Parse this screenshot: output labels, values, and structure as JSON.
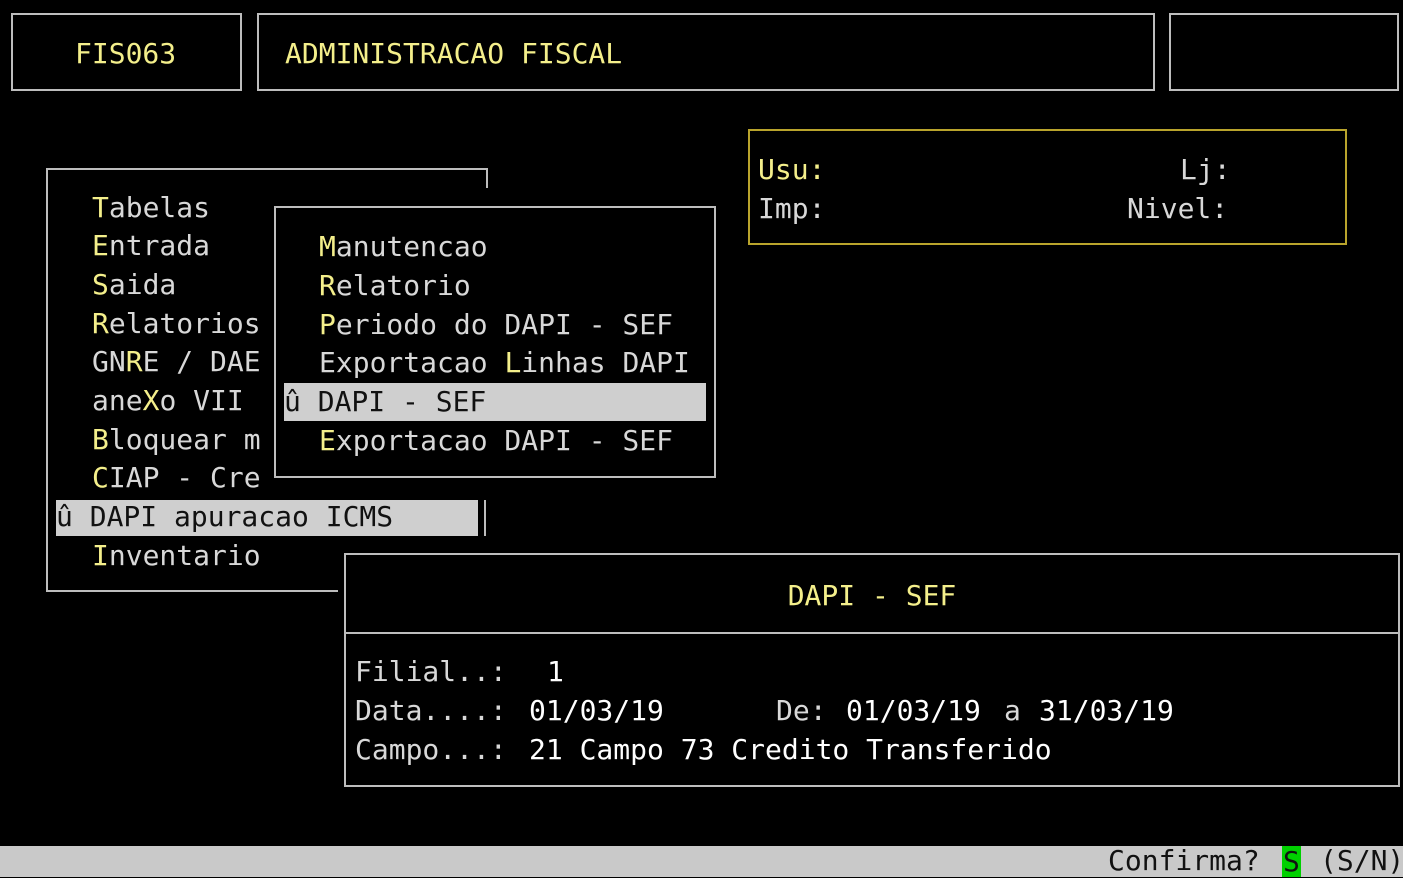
{
  "header": {
    "program_code": "FIS063",
    "title": "ADMINISTRACAO FISCAL",
    "right_box": ""
  },
  "info": {
    "usu_label": "Usu:",
    "lj_label": "Lj:",
    "imp_label": "Imp:",
    "nivel_label": "Nivel:"
  },
  "main_menu": {
    "items": [
      {
        "hot": "T",
        "rest": "abelas"
      },
      {
        "hot": "E",
        "rest": "ntrada"
      },
      {
        "hot": "S",
        "rest": "aida"
      },
      {
        "hot": "R",
        "rest": "elatorios"
      },
      {
        "pre": "GN",
        "hot": "R",
        "rest": "E / DAE"
      },
      {
        "pre": "ane",
        "hot": "X",
        "rest": "o VII"
      },
      {
        "hot": "B",
        "rest": "loquear m"
      },
      {
        "pre": "",
        "hot": "C",
        "rest": "IAP - Cre"
      },
      {
        "selected": "û DAPI apuracao ICMS"
      },
      {
        "hot": "I",
        "rest": "nventario"
      }
    ]
  },
  "sub_menu": {
    "items": [
      {
        "hot": "M",
        "rest": "anutencao"
      },
      {
        "hot": "R",
        "rest": "elatorio"
      },
      {
        "hot": "P",
        "rest": "eriodo do DAPI - SEF"
      },
      {
        "pre": "Exportacao ",
        "hot": "L",
        "rest": "inhas DAPI"
      },
      {
        "selected": "û DAPI - SEF"
      },
      {
        "hot": "E",
        "rest": "xportacao DAPI - SEF"
      }
    ]
  },
  "dialog": {
    "title": "DAPI - SEF",
    "filial_label": "Filial..:",
    "filial_value": "1",
    "data_label": "Data....:",
    "data_value": "01/03/19",
    "de_label": "De:",
    "de_from": "01/03/19",
    "de_sep": "a",
    "de_to": "31/03/19",
    "campo_label": "Campo...:",
    "campo_value": "21 Campo 73 Credito Transferido"
  },
  "status": {
    "prompt": "Confirma?",
    "answer": "S",
    "options": "(S/N)"
  },
  "colors": {
    "background": "#000000",
    "text": "#d8d8d8",
    "hotkey": "#f4ef8b",
    "highlight": "#cfcfcf",
    "answer": "#00d000"
  }
}
